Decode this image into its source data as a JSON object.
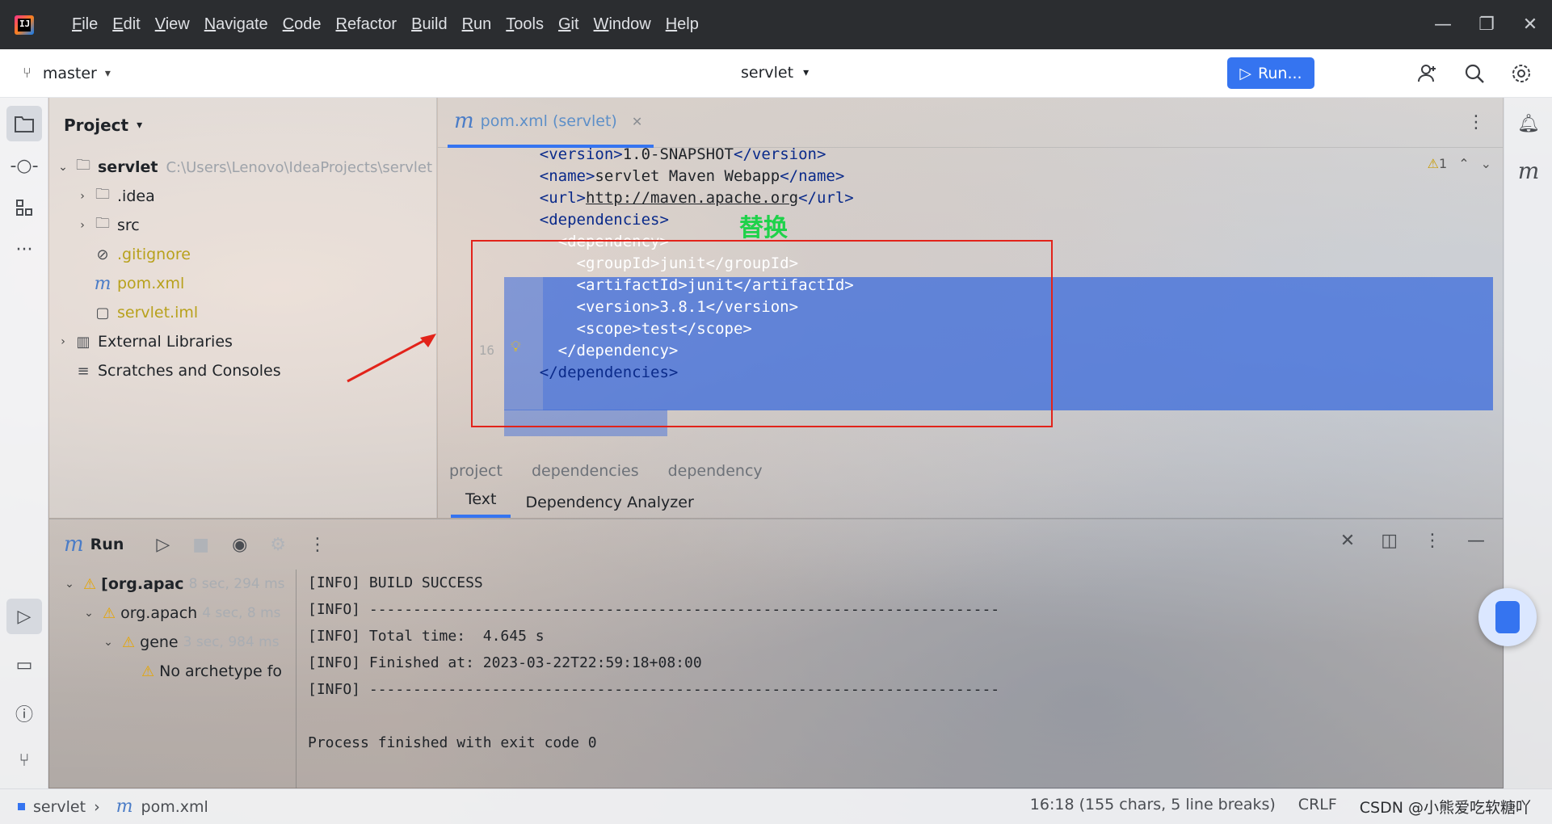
{
  "window": {
    "menu": [
      "File",
      "Edit",
      "View",
      "Navigate",
      "Code",
      "Refactor",
      "Build",
      "Run",
      "Tools",
      "Git",
      "Window",
      "Help"
    ],
    "controls": [
      "minimize",
      "restore",
      "close"
    ]
  },
  "toolbar": {
    "branch": "master",
    "project": "servlet",
    "run_label": "Run..."
  },
  "project_panel": {
    "title": "Project",
    "tree": [
      {
        "label": "servlet",
        "path": "C:\\Users\\Lenovo\\IdeaProjects\\servlet",
        "icon": "folder-icon",
        "level": 0,
        "expanded": true,
        "bold": true
      },
      {
        "label": ".idea",
        "icon": "folder-icon",
        "level": 1,
        "expanded": false
      },
      {
        "label": "src",
        "icon": "folder-icon",
        "level": 1,
        "expanded": false
      },
      {
        "label": ".gitignore",
        "icon": "ignore-icon",
        "level": 1,
        "color": "yellow"
      },
      {
        "label": "pom.xml",
        "icon": "maven-icon",
        "level": 1,
        "color": "yellow"
      },
      {
        "label": "servlet.iml",
        "icon": "file-icon",
        "level": 1,
        "color": "yellow"
      },
      {
        "label": "External Libraries",
        "icon": "library-icon",
        "level": 0,
        "expanded": false
      },
      {
        "label": "Scratches and Consoles",
        "icon": "scratches-icon",
        "level": 0
      }
    ]
  },
  "editor": {
    "tab_label": "pom.xml (servlet)",
    "inspection_count": "1",
    "annotation_text": "替换",
    "line_number_visible": "16",
    "lines": [
      {
        "indent": "    ",
        "open": "<version>",
        "text": "1.0-SNAPSHOT",
        "close": "</version>"
      },
      {
        "indent": "    ",
        "open": "<name>",
        "text": "servlet Maven Webapp",
        "close": "</name>"
      },
      {
        "indent": "    ",
        "open": "<url>",
        "text": "http://maven.apache.org",
        "close": "</url>",
        "link": true
      },
      {
        "indent": "    ",
        "open": "<dependencies>",
        "text": "",
        "close": ""
      },
      {
        "indent": "      ",
        "open": "<dependency>",
        "text": "",
        "close": ""
      },
      {
        "indent": "        ",
        "open": "<groupId>",
        "text": "junit",
        "close": "</groupId>"
      },
      {
        "indent": "        ",
        "open": "<artifactId>",
        "text": "junit",
        "close": "</artifactId>"
      },
      {
        "indent": "        ",
        "open": "<version>",
        "text": "3.8.1",
        "close": "</version>"
      },
      {
        "indent": "        ",
        "open": "<scope>",
        "text": "test",
        "close": "</scope>"
      },
      {
        "indent": "      ",
        "open": "</dependency>",
        "text": "",
        "close": ""
      },
      {
        "indent": "    ",
        "open": "</dependencies>",
        "text": "",
        "close": ""
      }
    ],
    "breadcrumb": [
      "project",
      "dependencies",
      "dependency"
    ],
    "bottom_tabs": [
      "Text",
      "Dependency Analyzer"
    ]
  },
  "run_panel": {
    "title": "Run",
    "tree": [
      {
        "label": "[org.apac",
        "time": "8 sec, 294 ms",
        "level": 0,
        "bold": true
      },
      {
        "label": "org.apach",
        "time": "4 sec, 8 ms",
        "level": 1
      },
      {
        "label": "gene",
        "time": "3 sec, 984 ms",
        "level": 2
      },
      {
        "label": "No archetype fo",
        "time": "",
        "level": 3
      }
    ],
    "console": [
      "[INFO] BUILD SUCCESS",
      "[INFO] ------------------------------------------------------------------------",
      "[INFO] Total time:  4.645 s",
      "[INFO] Finished at: 2023-03-22T22:59:18+08:00",
      "[INFO] ------------------------------------------------------------------------",
      "",
      "Process finished with exit code 0"
    ]
  },
  "statusbar": {
    "project": "servlet",
    "file": "pom.xml",
    "position": "16:18 (155 chars, 5 line breaks)",
    "line_sep": "CRLF",
    "watermark": "CSDN @小熊爱吃软糖吖"
  },
  "colors": {
    "accent": "#3574f0",
    "annotation_red": "#e2231a",
    "annotation_green": "#1ed24a",
    "warning": "#e6a500"
  }
}
